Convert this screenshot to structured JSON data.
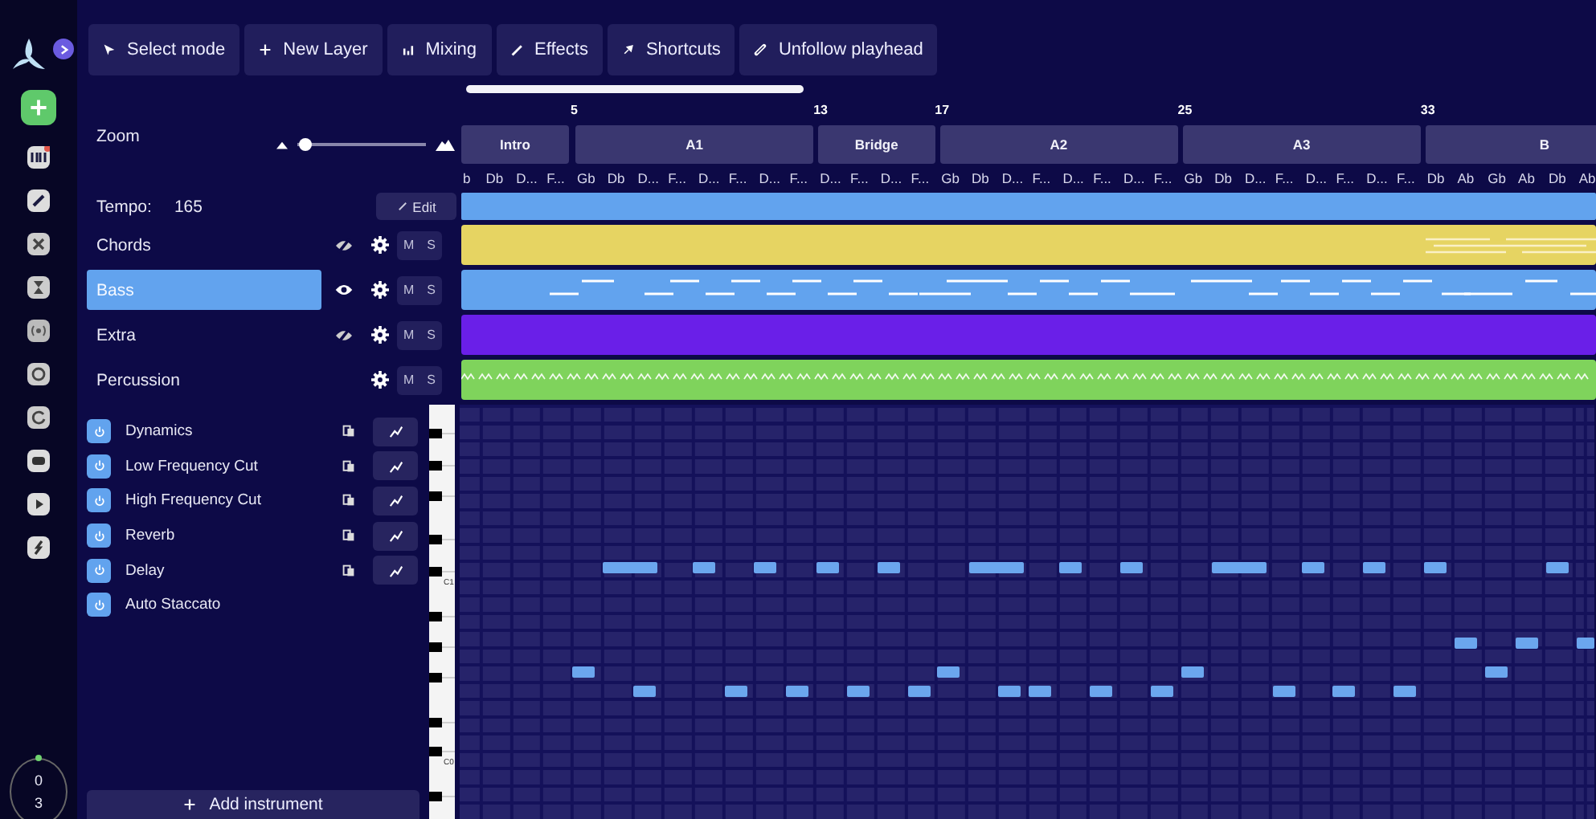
{
  "toolbar": [
    {
      "label": "Select mode"
    },
    {
      "label": "New Layer"
    },
    {
      "label": "Mixing"
    },
    {
      "label": "Effects"
    },
    {
      "label": "Shortcuts"
    },
    {
      "label": "Unfollow playhead"
    }
  ],
  "zoom": {
    "label": "Zoom",
    "level": 0.06
  },
  "tempo": {
    "label": "Tempo:",
    "value": "165",
    "edit": "Edit"
  },
  "tracks": [
    {
      "name": "Chords",
      "kind": "chords",
      "color": "#e6d462",
      "selected": false,
      "visible": false,
      "mute": "M",
      "solo": "S"
    },
    {
      "name": "Bass",
      "kind": "bass",
      "color": "#62a3ee",
      "selected": true,
      "visible": true,
      "mute": "M",
      "solo": "S"
    },
    {
      "name": "Extra",
      "kind": "synth",
      "color": "#6a1fe8",
      "selected": false,
      "visible": false,
      "mute": "M",
      "solo": "S"
    },
    {
      "name": "Percussion",
      "kind": "drums",
      "color": "#7fd35c",
      "selected": false,
      "mute": "M",
      "solo": "S"
    }
  ],
  "timeline": {
    "markers": [
      "5",
      "13",
      "17",
      "25",
      "33"
    ],
    "sections": [
      "Intro",
      "A1",
      "Bridge",
      "A2",
      "A3",
      "B"
    ],
    "chords": [
      "b",
      "Db",
      "D...",
      "F...",
      "Gb",
      "Db",
      "D...",
      "F...",
      "D...",
      "F...",
      "D...",
      "F...",
      "D...",
      "F...",
      "D...",
      "F...",
      "Gb",
      "Db",
      "D...",
      "F...",
      "D...",
      "F...",
      "D...",
      "F...",
      "Gb",
      "Db",
      "D...",
      "F...",
      "D...",
      "F...",
      "D...",
      "F...",
      "Db",
      "Ab",
      "Gb",
      "Ab",
      "Db",
      "Ab"
    ]
  },
  "effects": [
    {
      "name": "Dynamics",
      "enabled": true,
      "kind": "automatable"
    },
    {
      "name": "Low Frequency Cut",
      "enabled": true,
      "kind": "automatable"
    },
    {
      "name": "High Frequency Cut",
      "enabled": true,
      "kind": "automatable"
    },
    {
      "name": "Reverb",
      "enabled": true,
      "kind": "automatable"
    },
    {
      "name": "Delay",
      "enabled": true,
      "kind": "automatable"
    },
    {
      "name": "Auto Staccato",
      "enabled": true,
      "kind": "toggle"
    }
  ],
  "add_instrument": "Add instrument",
  "piano": {
    "labels": [
      "C1",
      "C0"
    ]
  },
  "counter": {
    "value": "0",
    "total": "3"
  }
}
